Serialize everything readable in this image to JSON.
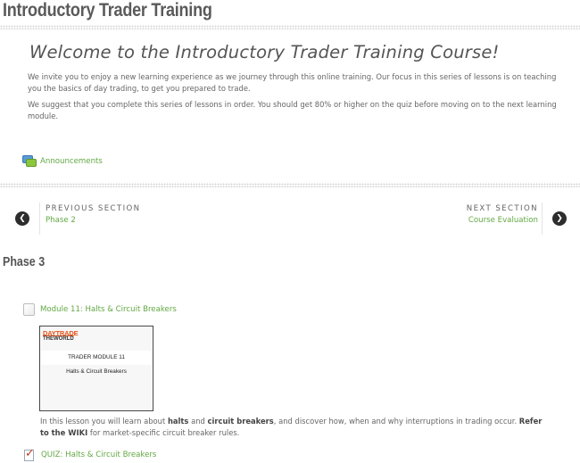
{
  "page": {
    "title": "Introductory Trader Training"
  },
  "intro": {
    "heading": "Welcome to the Introductory Trader Training Course!",
    "paragraph1": "We invite you to enjoy a new learning experience as we journey through this online training.  Our focus in this series of lessons is on teaching you the basics of day trading, to get you prepared to trade.",
    "paragraph2": "We suggest that you complete this series of lessons in order. You should get 80% or higher on the quiz before moving on to the next learning module."
  },
  "announcements": {
    "label": "Announcements",
    "icon": "forum-icon"
  },
  "navigation": {
    "previous": {
      "heading": "PREVIOUS SECTION",
      "link": "Phase 2",
      "icon": "chevron-left-icon"
    },
    "next": {
      "heading": "NEXT SECTION",
      "link": "Course Evaluation",
      "icon": "chevron-right-icon"
    }
  },
  "section": {
    "title": "Phase 3",
    "module": {
      "label": "Module 11: Halts & Circuit Breakers",
      "icon": "page-icon",
      "thumbnail": {
        "logo_line1": "DAYTRADE",
        "logo_line2": "THEWORLD",
        "title_line1": "TRADER MODULE 11",
        "title_line2": "Halts & Circuit Breakers"
      },
      "description": {
        "part1": "In this lesson you will learn about ",
        "bold1": "halts",
        "part2": " and ",
        "bold2": "circuit breakers",
        "part3": ", and discover how, when and why interruptions in trading occur. ",
        "bold3": "Refer to the WIKI",
        "part4": " for market-specific circuit breaker rules."
      }
    },
    "quiz": {
      "label": "QUIZ: Halts & Circuit Breakers",
      "icon": "quiz-icon"
    }
  },
  "colors": {
    "link": "#62a843",
    "text": "#666666",
    "arrow": "#2d2d2d",
    "logo": "#e5541c"
  }
}
